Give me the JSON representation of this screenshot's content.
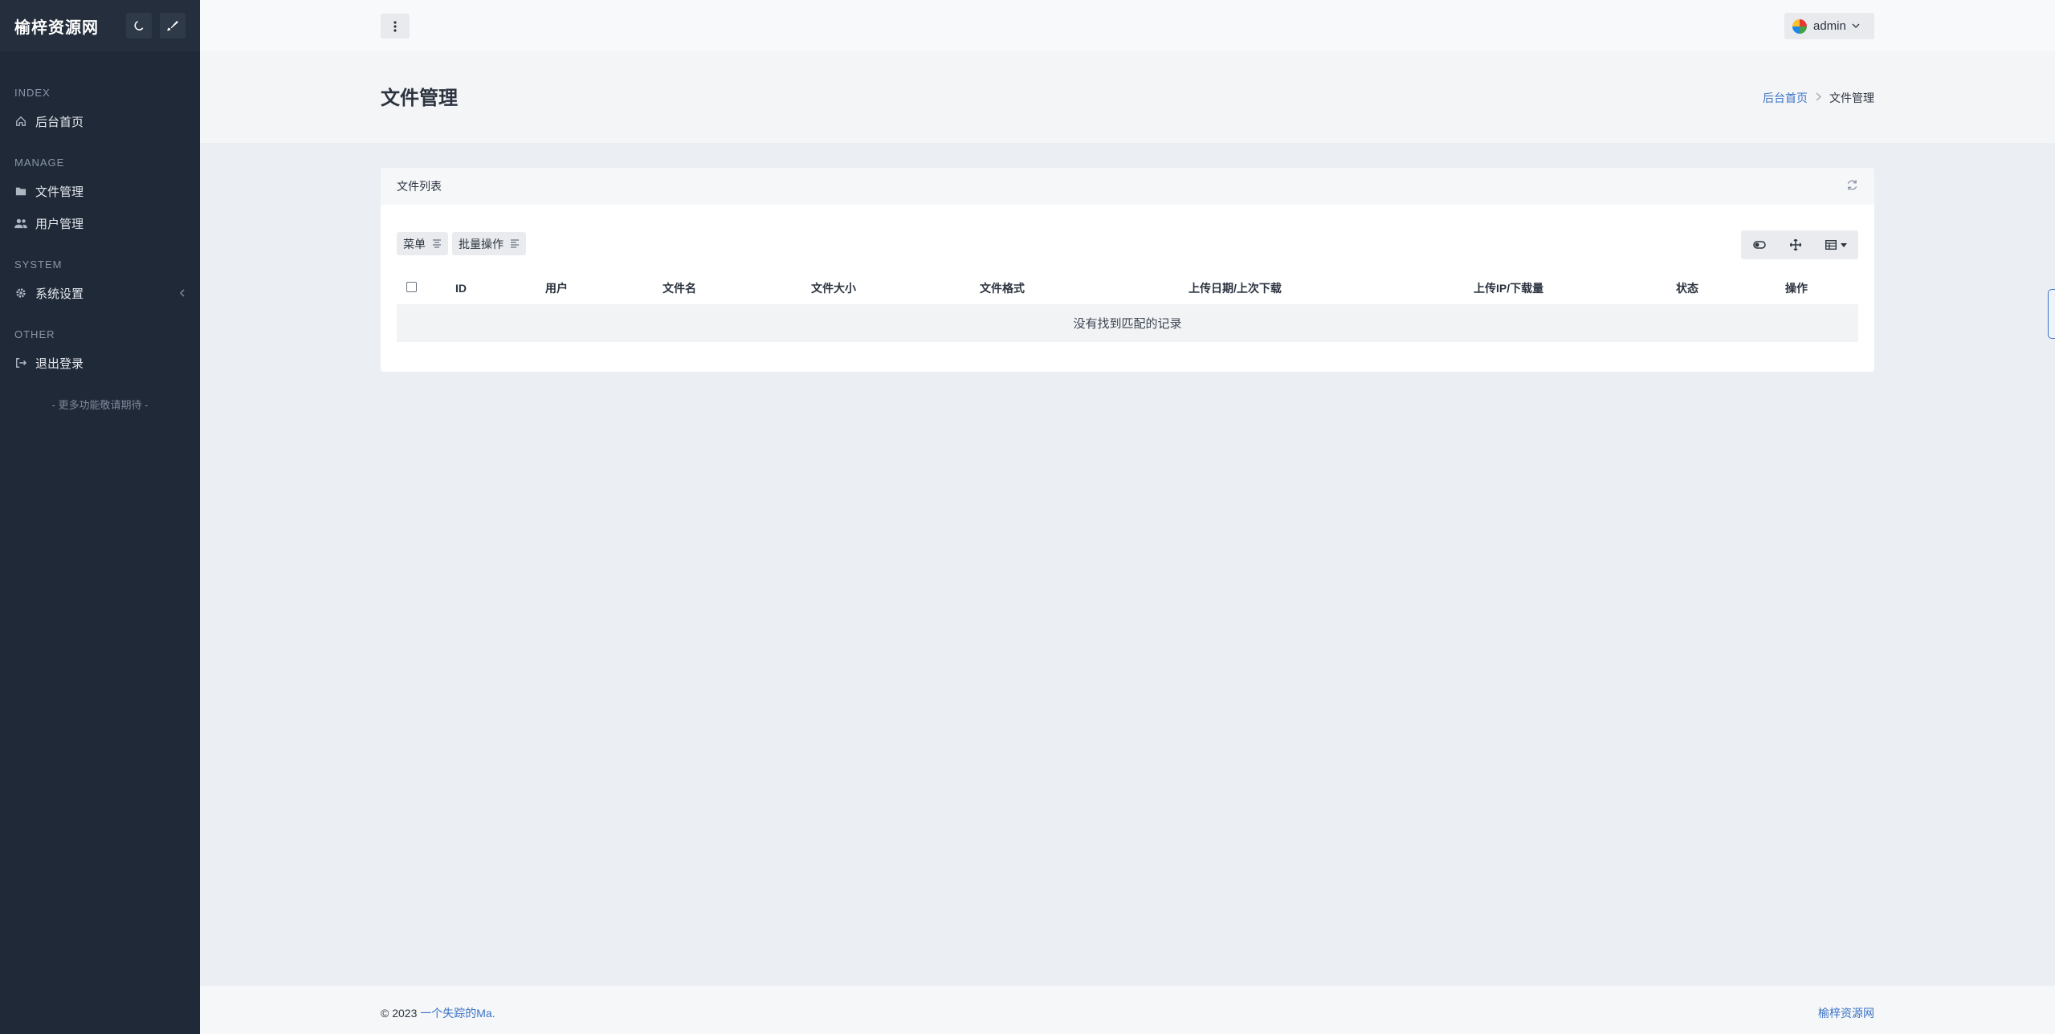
{
  "sidebar": {
    "brand": "榆梓资源网",
    "sections": {
      "index": "INDEX",
      "manage": "MANAGE",
      "system": "SYSTEM",
      "other": "OTHER"
    },
    "items": {
      "home": "后台首页",
      "files": "文件管理",
      "users": "用户管理",
      "settings": "系统设置",
      "logout": "退出登录"
    },
    "more": "- 更多功能敬请期待 -"
  },
  "topbar": {
    "user": "admin"
  },
  "page": {
    "title": "文件管理",
    "breadcrumb": {
      "home": "后台首页",
      "current": "文件管理"
    }
  },
  "card": {
    "title": "文件列表",
    "toolbar": {
      "menu": "菜单",
      "batch": "批量操作"
    },
    "columns": [
      "ID",
      "用户",
      "文件名",
      "文件大小",
      "文件格式",
      "上传日期/上次下载",
      "上传IP/下载量",
      "状态",
      "操作"
    ],
    "empty": "没有找到匹配的记录"
  },
  "footer": {
    "copyright": "© 2023",
    "author": "一个失踪的Ma.",
    "site": "榆梓资源网"
  },
  "colors": {
    "sidebar": "#1f2937",
    "accent": "#3b73c5"
  }
}
